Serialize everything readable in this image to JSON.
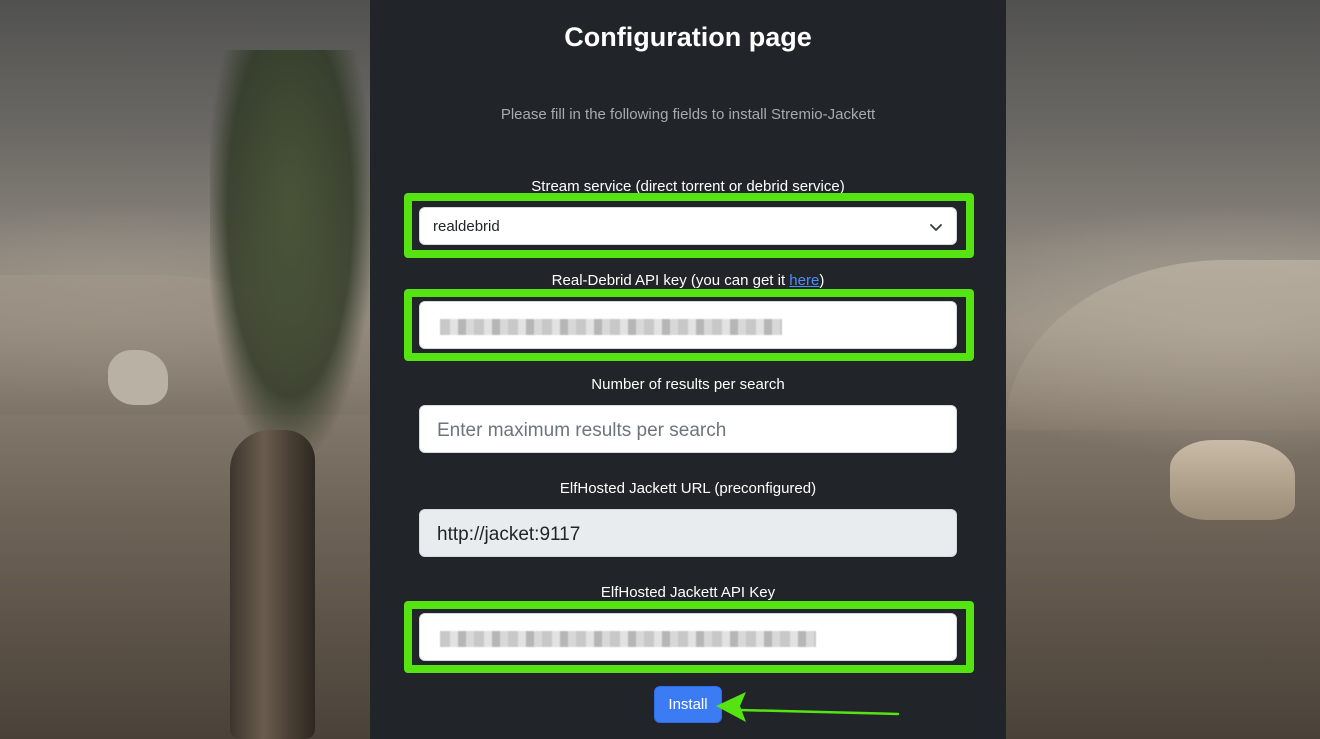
{
  "page": {
    "title": "Configuration page",
    "subtitle": "Please fill in the following fields to install Stremio-Jackett"
  },
  "stream_service": {
    "label": "Stream service (direct torrent or debrid service)",
    "selected": "realdebrid"
  },
  "api_key": {
    "label_prefix": "Real-Debrid API key (you can get it ",
    "link_text": "here",
    "label_suffix": ")"
  },
  "max_results": {
    "label": "Number of results per search",
    "placeholder": "Enter maximum results per search"
  },
  "jackett_url": {
    "label": "ElfHosted Jackett URL (preconfigured)",
    "value": "http://jacket:9117"
  },
  "jackett_api_key": {
    "label": "ElfHosted Jackett API Key"
  },
  "install_button": {
    "label": "Install"
  },
  "colors": {
    "panel_bg": "#212428",
    "highlight": "#55e312",
    "button": "#3b7cf5",
    "link": "#4d8dff"
  },
  "icons": {
    "select_chevron": "chevron-down-icon",
    "annotation_arrow": "arrow-left-icon"
  }
}
